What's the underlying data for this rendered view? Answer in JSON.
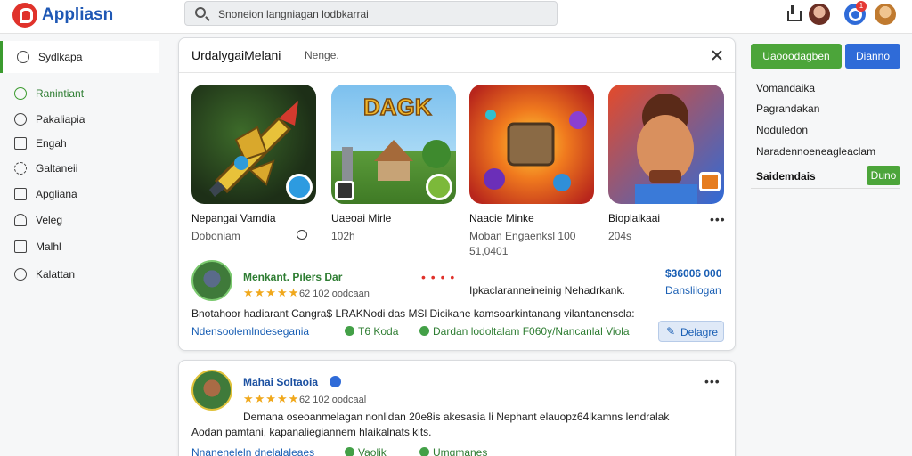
{
  "app": {
    "title": "Appliasn"
  },
  "search": {
    "text": "Snoneion langniagan lodbkarrai"
  },
  "header": {
    "notification_count": "1"
  },
  "sidebar": {
    "items": [
      {
        "label": "Sydlkapa",
        "icon": "circle-icon",
        "active": true
      },
      {
        "label": "Ranintiant",
        "icon": "circle-icon",
        "green": true
      },
      {
        "label": "Pakaliapia",
        "icon": "circle-icon"
      },
      {
        "label": "Engah",
        "icon": "card-icon"
      },
      {
        "label": "Galtaneii",
        "icon": "dash-circle-icon"
      },
      {
        "label": "Apgliana",
        "icon": "square-icon"
      },
      {
        "label": "Veleg",
        "icon": "bell-icon"
      },
      {
        "label": "Malhl",
        "icon": "box-icon"
      },
      {
        "label": "Kalattan",
        "icon": "circle-icon"
      }
    ]
  },
  "card1": {
    "title": "UrdalygaiMelani",
    "subtitle": "Nenge.",
    "games": [
      {
        "name": "Nepangai Vamdia",
        "meta": "Doboniam",
        "meta2": "",
        "has_comment_icon": true
      },
      {
        "name": "Uaeoai Mirle",
        "meta": "102h",
        "meta2": ""
      },
      {
        "name": "Naacie Minke",
        "meta": "Moban Engaenksl   100",
        "meta2": "51,0401"
      },
      {
        "name": "Bioplaikaai",
        "meta": "204s",
        "meta2": ""
      }
    ],
    "review": {
      "name": "Menkant. Pilers Dar",
      "rating": "★★★★★",
      "meta": "62  102  oodcaan",
      "mid_text": "Ipkaclaranneineinig Nehadrkank.",
      "price": "$36006 000",
      "price_link": "Danslilogan",
      "dots": "• • • •",
      "text": "Bnotahoor hadiarant Cangra$ LRAKNodi das  MSl Dicikane kamsoarkintanang vilantanenscla:",
      "link": "Ndensoolemlndesegania",
      "check1": "T6 Koda",
      "check2": "Dardan lodoltalam  F060y/Nancanlal Viola",
      "button": "Delagre"
    }
  },
  "card2": {
    "review": {
      "name": "Mahai Soltaoia",
      "rating": "★★★★★",
      "meta": "62  102  oodcaal",
      "text1": "Demana oseoanmelagan nonlidan 20e8is akesasia li Nephant elauopz64lkamns lendralak",
      "text2": "Aodan pamtani, kapanaliegiannem hlaikalnats kits.",
      "link": "Nnaneneleln dnelalaleaes",
      "check1": "Vaolik",
      "check2": "Umgmanes",
      "ellipsis": "•••"
    }
  },
  "right_panel": {
    "primary_button": "Uaooodagben",
    "secondary_button": "Dianno",
    "links": [
      "Vomandaika",
      "Pagrandakan",
      "Noduledon",
      "Naradennoeneagleaclam"
    ],
    "section_label": "Saidemdais",
    "small_button": "Duno"
  },
  "colors": {
    "accent_green": "#4ca53a",
    "accent_blue": "#2f6bd8",
    "brand_red": "#e0322b"
  }
}
